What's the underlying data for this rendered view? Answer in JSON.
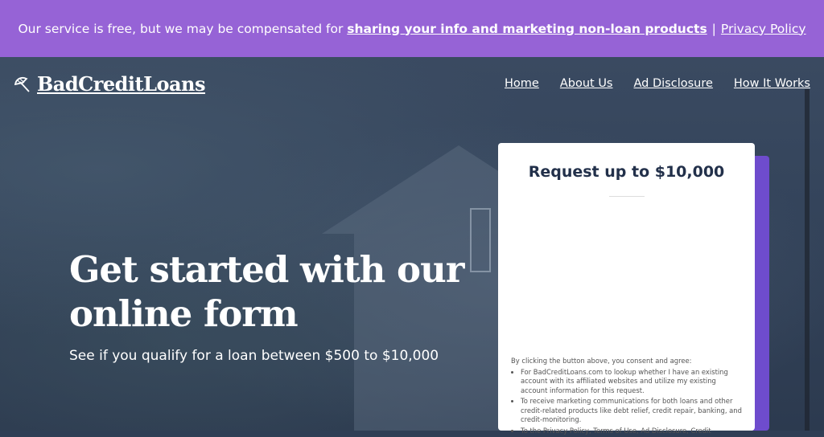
{
  "topbar": {
    "prefix": "Our service is free, but we may be compensated for",
    "link_sharing": "sharing your info and marketing non-loan products",
    "separator": "|",
    "link_privacy": "Privacy Policy"
  },
  "header": {
    "logo_text": "BadCreditLoans",
    "nav": [
      "Home",
      "About Us",
      "Ad Disclosure",
      "How It Works"
    ]
  },
  "hero": {
    "headline": "Get started with our online form",
    "subheadline": "See if you qualify for a loan between $500 to $10,000"
  },
  "form_card": {
    "title": "Request up to $10,000",
    "consent_intro": "By clicking the button above, you consent and agree:",
    "consent_items": [
      "For BadCreditLoans.com to lookup whether I have an existing account with its affiliated websites and utilize my existing account information for this request.",
      "To receive marketing communications for both loans and other credit-related products like debt relief, credit repair, banking, and credit-monitoring.",
      "To the Privacy Policy, Terms of Use, Ad Disclosure, Credit"
    ]
  },
  "colors": {
    "topbar_bg": "#9663d6",
    "card_accent": "#6e4ccd"
  }
}
